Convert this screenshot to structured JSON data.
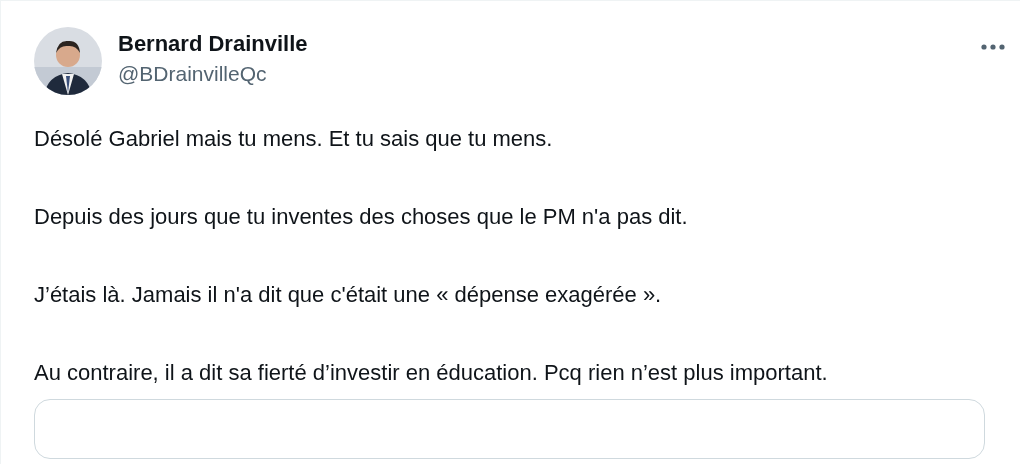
{
  "author": {
    "name": "Bernard Drainville",
    "handle": "@BDrainvilleQc"
  },
  "paragraphs": [
    "Désolé Gabriel mais tu mens. Et tu sais que tu mens.",
    "Depuis des jours que tu inventes des choses que le PM n'a pas dit.",
    "J’étais là. Jamais il n'a dit que c'était une « dépense exagérée ».",
    "Au contraire, il a dit sa fierté d’investir en éducation. Pcq rien n’est plus important."
  ],
  "quoted_post": {
    "kind": "frame"
  }
}
